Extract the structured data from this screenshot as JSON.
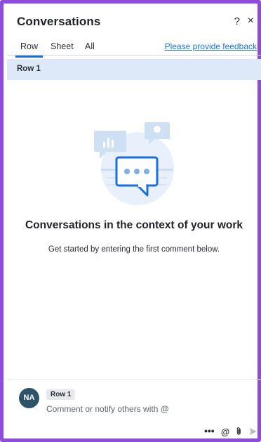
{
  "header": {
    "title": "Conversations",
    "help_glyph": "?",
    "close_glyph": "×"
  },
  "tabs": [
    {
      "label": "Row",
      "active": true
    },
    {
      "label": "Sheet",
      "active": false
    },
    {
      "label": "All",
      "active": false
    }
  ],
  "feedback_link": "Please provide feedback",
  "context": {
    "label": "Row 1"
  },
  "empty_state": {
    "heading": "Conversations in the context of your work",
    "subtext": "Get started by entering the first comment below."
  },
  "composer": {
    "avatar_initials": "NA",
    "context_chip": "Row 1",
    "placeholder": "Comment or notify others with @",
    "more_glyph": "•••",
    "mention_glyph": "@"
  },
  "colors": {
    "accent": "#1a6fd8",
    "context_bar": "#dde9f8",
    "avatar": "#2e5268",
    "frame": "#8e4bdc"
  },
  "icons": [
    "help-icon",
    "close-icon",
    "chat-illustration",
    "more-icon",
    "mention-icon",
    "attach-icon",
    "send-icon"
  ]
}
